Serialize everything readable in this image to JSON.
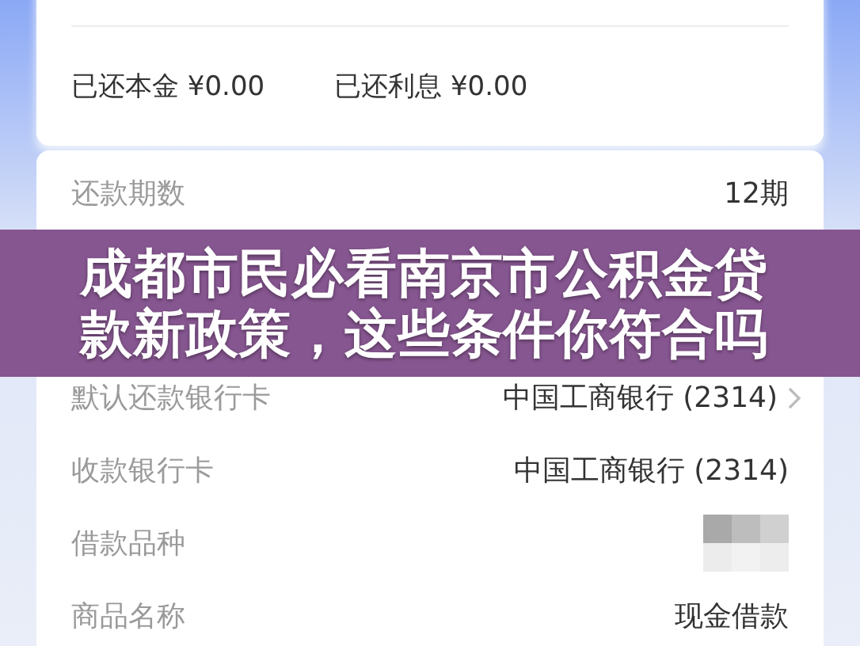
{
  "repaid": [
    {
      "label": "已还本金",
      "amount": "¥0.00"
    },
    {
      "label": "已还利息",
      "amount": "¥0.00"
    }
  ],
  "details_top": [
    {
      "kind": "text",
      "label": "还款期数",
      "value": "12期"
    }
  ],
  "banner": {
    "title": "成都市民必看南京市公积金贷款新政策，这些条件你符合吗"
  },
  "details_bottom": [
    {
      "kind": "link",
      "label": "默认还款银行卡",
      "value": "中国工商银行 (2314)"
    },
    {
      "kind": "text",
      "label": "收款银行卡",
      "value": "中国工商银行 (2314)"
    },
    {
      "kind": "redacted",
      "label": "借款品种"
    },
    {
      "kind": "text",
      "label": "商品名称",
      "value": "现金借款"
    }
  ]
}
